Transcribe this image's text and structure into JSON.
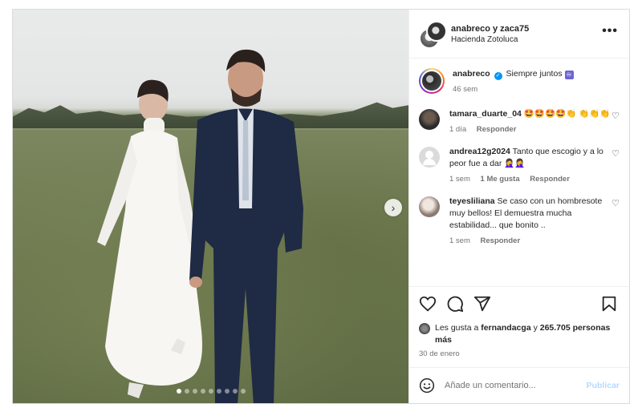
{
  "header": {
    "username_line": "anabreco y zaca75",
    "location": "Hacienda Zotoluca",
    "more_label": "•••"
  },
  "caption": {
    "username": "anabreco",
    "verified_mark": "✓",
    "text": "Siempre juntos",
    "emoji": "♾",
    "time": "46 sem"
  },
  "comments": [
    {
      "username": "tamara_duarte_04",
      "text": "🤩🤩🤩🤩👏 👏👏👏",
      "time": "1 día",
      "likes": "",
      "reply": "Responder"
    },
    {
      "username": "andrea12g2024",
      "text": "Tanto que escogio y a lo peor fue a dar 🤦‍♀️🤦‍♀️",
      "time": "1 sem",
      "likes": "1 Me gusta",
      "reply": "Responder"
    },
    {
      "username": "teyesliliana",
      "text": "Se caso con un hombresote muy bellos! El demuestra mucha estabilidad... que bonito ..",
      "time": "1 sem",
      "likes": "",
      "reply": "Responder"
    }
  ],
  "likes": {
    "prefix": "Les gusta a",
    "user": "fernandacga",
    "joiner": "y",
    "count": "265.705 personas más"
  },
  "date": "30 de enero",
  "add_comment": {
    "placeholder": "Añade un comentario...",
    "publish": "Publicar"
  },
  "media": {
    "next_arrow": "›",
    "slide_count": 9,
    "active_slide": 0
  },
  "icons": {
    "heart": "heart-outline-icon",
    "comment": "comment-icon",
    "share": "share-icon",
    "save": "bookmark-icon",
    "emoji": "smile-icon"
  },
  "colors": {
    "verified": "#0095f6",
    "publish_disabled": "#b3dbff",
    "secondary_text": "#737373"
  }
}
